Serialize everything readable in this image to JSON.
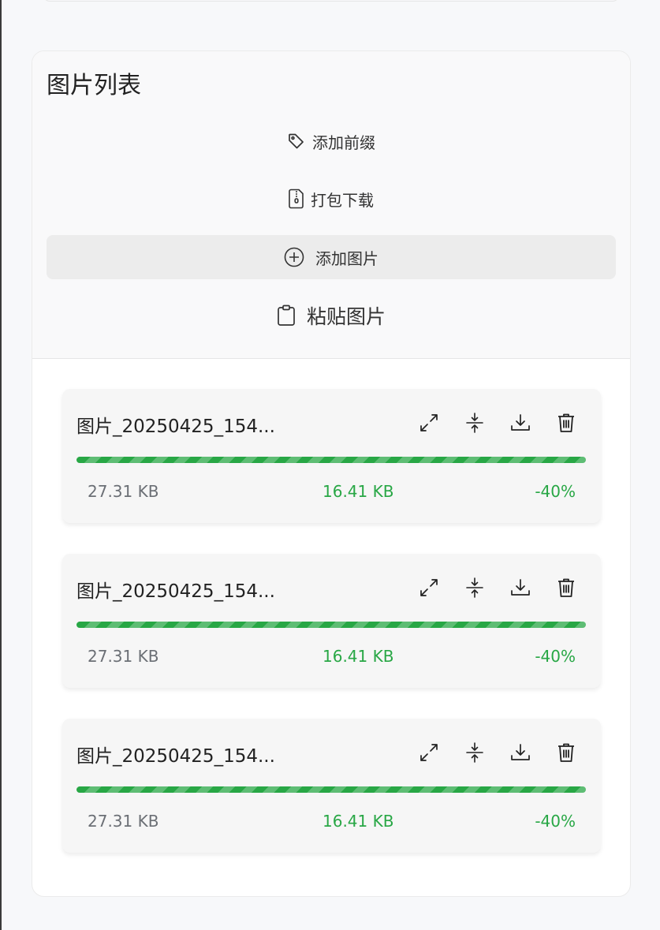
{
  "panel": {
    "title": "图片列表",
    "actions": {
      "add_prefix": "添加前缀",
      "zip_download": "打包下载",
      "add_image": "添加图片",
      "paste_image": "粘贴图片"
    }
  },
  "images": [
    {
      "name": "图片_20250425_154...",
      "original_size": "27.31 KB",
      "compressed_size": "16.41 KB",
      "ratio": "-40%",
      "progress": 100
    },
    {
      "name": "图片_20250425_154...",
      "original_size": "27.31 KB",
      "compressed_size": "16.41 KB",
      "ratio": "-40%",
      "progress": 100
    },
    {
      "name": "图片_20250425_154...",
      "original_size": "27.31 KB",
      "compressed_size": "16.41 KB",
      "ratio": "-40%",
      "progress": 100
    }
  ],
  "icons": {
    "add_prefix": "tag-icon",
    "zip_download": "zip-file-icon",
    "add_image": "plus-circle-icon",
    "paste_image": "clipboard-icon",
    "expand": "expand-icon",
    "compress": "compress-icon",
    "download": "download-icon",
    "delete": "trash-icon"
  },
  "colors": {
    "success": "#28a745",
    "muted_text": "#6b6f75",
    "add_button_bg": "#ececec"
  }
}
